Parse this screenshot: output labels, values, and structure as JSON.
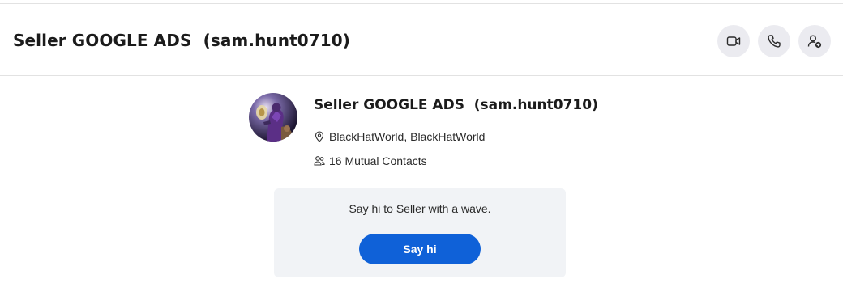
{
  "header": {
    "title": "Seller GOOGLE ADS  (sam.hunt0710)",
    "actions": [
      {
        "icon": "video-camera-icon"
      },
      {
        "icon": "phone-icon"
      },
      {
        "icon": "add-contact-icon"
      }
    ]
  },
  "profile": {
    "name": "Seller GOOGLE ADS  (sam.hunt0710)",
    "location": "BlackHatWorld, BlackHatWorld",
    "location_icon": "location-pin-icon",
    "mutual_contacts": "16 Mutual Contacts",
    "mutual_icon": "people-icon"
  },
  "wave": {
    "message": "Say hi to Seller with a wave.",
    "button_label": "Say hi"
  },
  "colors": {
    "accent": "#0f61d8",
    "card_background": "#f1f3f6",
    "icon_button_background": "#ebebf0"
  }
}
